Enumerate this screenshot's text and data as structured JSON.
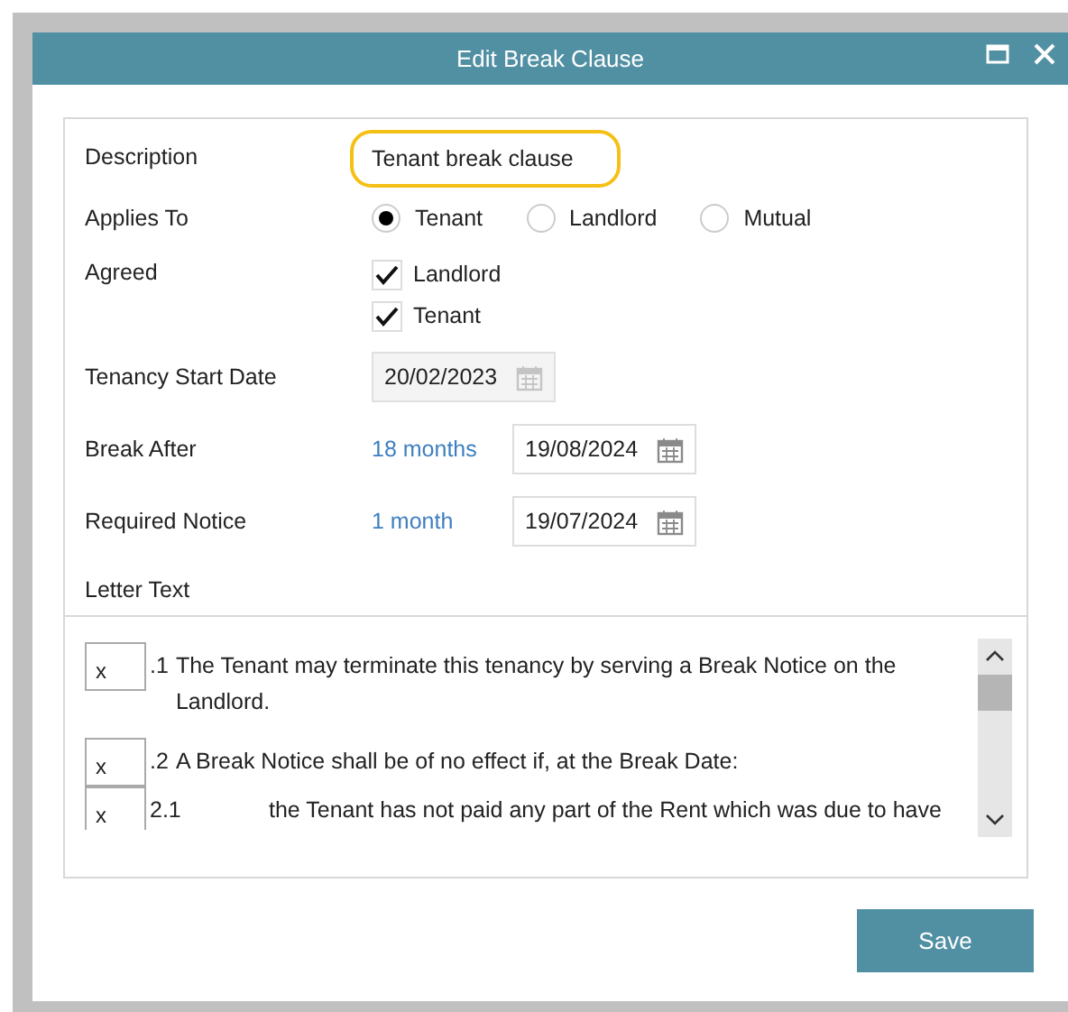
{
  "window": {
    "title": "Edit Break Clause"
  },
  "description": {
    "label": "Description",
    "value": "Tenant break clause"
  },
  "applies_to": {
    "label": "Applies To",
    "options": [
      {
        "label": "Tenant",
        "selected": true
      },
      {
        "label": "Landlord",
        "selected": false
      },
      {
        "label": "Mutual",
        "selected": false
      }
    ]
  },
  "agreed": {
    "label": "Agreed",
    "items": [
      {
        "label": "Landlord",
        "checked": true
      },
      {
        "label": "Tenant",
        "checked": true
      }
    ]
  },
  "dates": [
    {
      "label": "Tenancy Start Date",
      "value": "20/02/2023",
      "disabled": true
    },
    {
      "label": "Break After",
      "period": "18 months",
      "value": "19/08/2024",
      "disabled": false
    },
    {
      "label": "Required Notice",
      "period": "1 month",
      "value": "19/07/2024",
      "disabled": false
    }
  ],
  "letter": {
    "label": "Letter Text",
    "paragraphs": [
      {
        "field": "x",
        "number": ".1",
        "text": "The Tenant may terminate this tenancy by serving a Break Notice on the Landlord."
      },
      {
        "field": "x",
        "number": ".2",
        "text": "A Break Notice shall be of no effect if, at the Break Date:"
      },
      {
        "field": "x",
        "number": "2.1",
        "text": "the Tenant has not paid any part of the Rent which was due to have"
      }
    ]
  },
  "buttons": [
    "Save"
  ]
}
